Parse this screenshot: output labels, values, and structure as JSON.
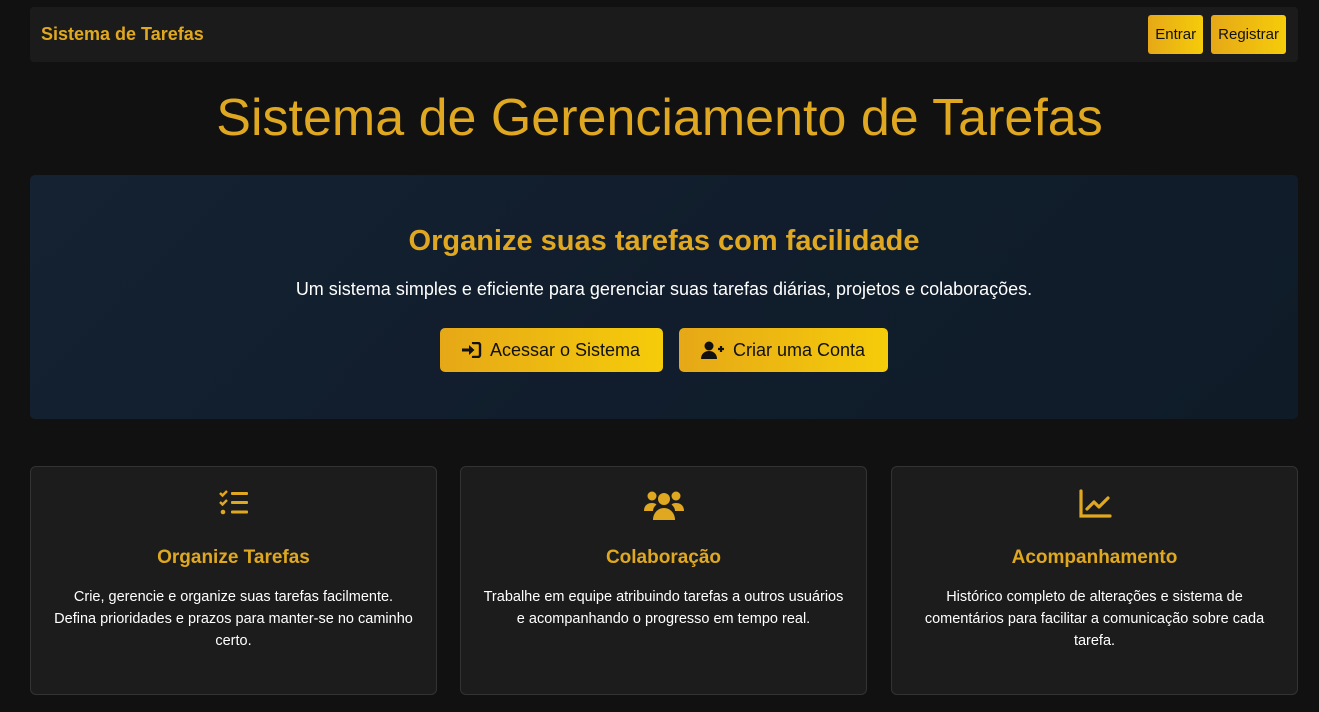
{
  "navbar": {
    "brand": "Sistema de Tarefas",
    "login_label": "Entrar",
    "register_label": "Registrar"
  },
  "page_title": "Sistema de Gerenciamento de Tarefas",
  "hero": {
    "title": "Organize suas tarefas com facilidade",
    "text": "Um sistema simples e eficiente para gerenciar suas tarefas diárias, projetos e colaborações.",
    "access_button": {
      "label": "Acessar o Sistema",
      "icon": "sign-in-icon"
    },
    "create_button": {
      "label": "Criar uma Conta",
      "icon": "user-plus-icon"
    }
  },
  "features": [
    {
      "icon": "tasks-list-icon",
      "title": "Organize Tarefas",
      "text": "Crie, gerencie e organize suas tarefas facilmente. Defina prioridades e prazos para manter-se no caminho certo."
    },
    {
      "icon": "users-icon",
      "title": "Colaboração",
      "text": "Trabalhe em equipe atribuindo tarefas a outros usuários e acompanhando o progresso em tempo real."
    },
    {
      "icon": "chart-line-icon",
      "title": "Acompanhamento",
      "text": "Histórico completo de alterações e sistema de comentários para facilitar a comunicação sobre cada tarefa."
    }
  ],
  "colors": {
    "accent": "#e0a820",
    "button_gradient_start": "#e6a817",
    "button_gradient_end": "#f5cc0a",
    "background": "#111111",
    "hero_background": "#132131",
    "card_background": "#1c1c1c"
  }
}
